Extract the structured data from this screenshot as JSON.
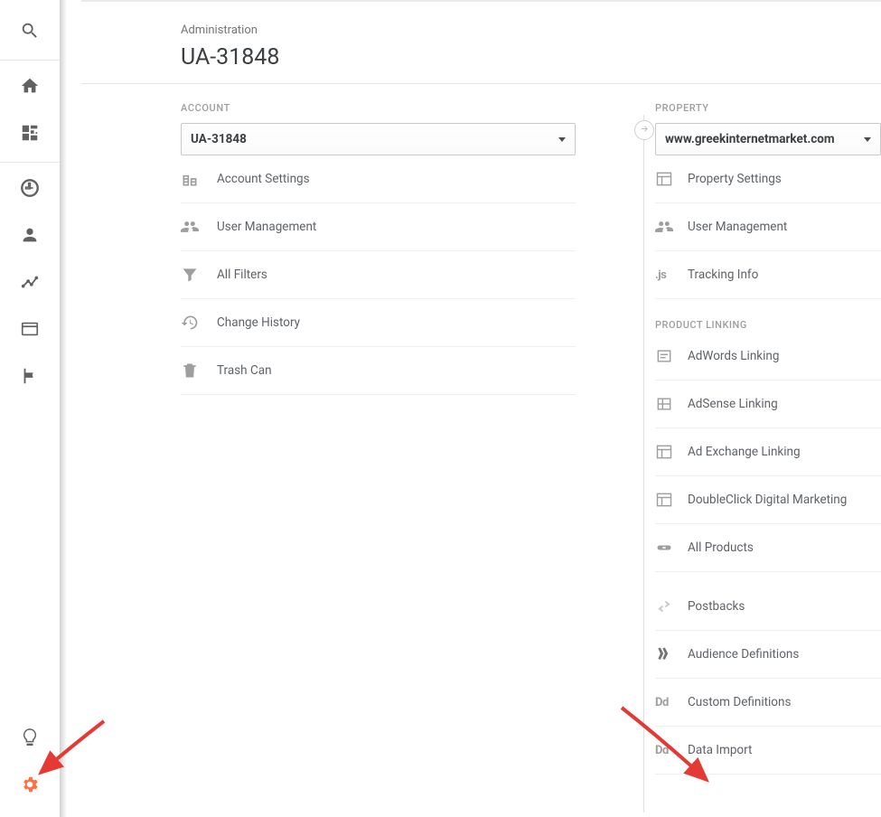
{
  "page": {
    "subtitle": "Administration",
    "title": "UA-31848"
  },
  "columns": {
    "account": {
      "label": "ACCOUNT",
      "selected": "UA-31848",
      "items": [
        {
          "icon": "building-icon",
          "label": "Account Settings"
        },
        {
          "icon": "people-icon",
          "label": "User Management"
        },
        {
          "icon": "filter-icon",
          "label": "All Filters"
        },
        {
          "icon": "history-icon",
          "label": "Change History"
        },
        {
          "icon": "trash-icon",
          "label": "Trash Can"
        }
      ]
    },
    "property": {
      "label": "PROPERTY",
      "selected": "www.greekinternetmarket.com",
      "items_main": [
        {
          "icon": "layout-icon",
          "label": "Property Settings"
        },
        {
          "icon": "people-icon",
          "label": "User Management"
        },
        {
          "icon": "js-icon",
          "label": "Tracking Info"
        }
      ],
      "section_label": "PRODUCT LINKING",
      "items_linking": [
        {
          "icon": "adwords-icon",
          "label": "AdWords Linking"
        },
        {
          "icon": "adsense-icon",
          "label": "AdSense Linking"
        },
        {
          "icon": "layout-icon",
          "label": "Ad Exchange Linking"
        },
        {
          "icon": "layout-icon",
          "label": "DoubleClick Digital Marketing"
        },
        {
          "icon": "link-icon",
          "label": "All Products"
        }
      ],
      "items_other": [
        {
          "icon": "postback-icon",
          "label": "Postbacks"
        },
        {
          "icon": "audience-icon",
          "label": "Audience Definitions"
        },
        {
          "icon": "dd-icon",
          "label": "Custom Definitions"
        },
        {
          "icon": "dd-icon",
          "label": "Data Import"
        }
      ]
    }
  },
  "annotations": {
    "arrow_color": "#e53935"
  }
}
